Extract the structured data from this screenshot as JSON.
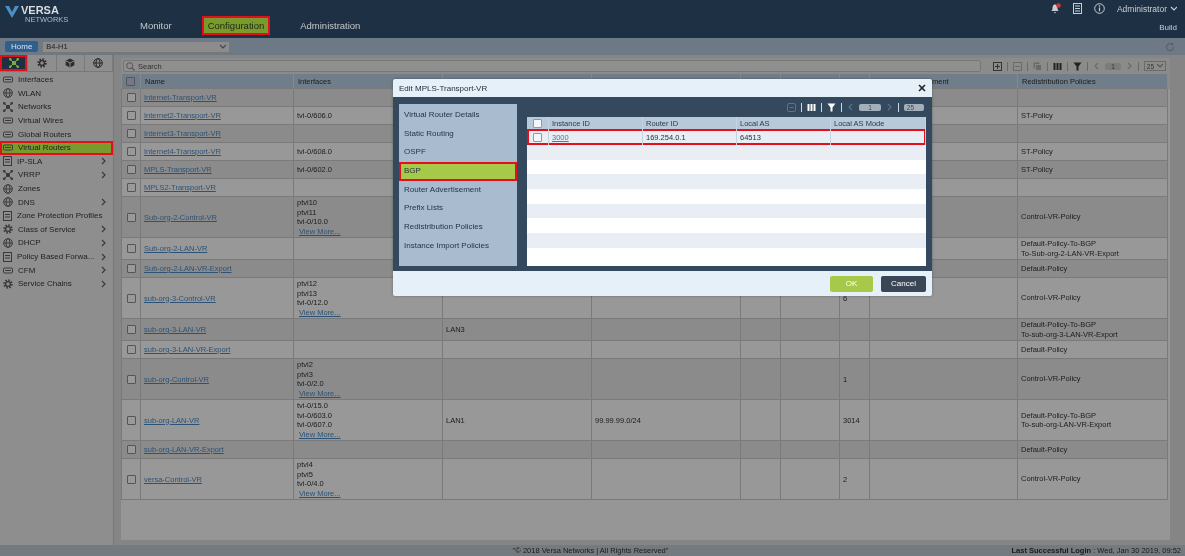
{
  "header": {
    "logo_text": "VERSA",
    "logo_subtext": "NETWORKS",
    "nav": [
      {
        "label": "Monitor",
        "selected": false,
        "highlighted": false
      },
      {
        "label": "Configuration",
        "selected": true,
        "highlighted": true
      },
      {
        "label": "Administration",
        "selected": false,
        "highlighted": false
      }
    ],
    "user": "Administrator",
    "build": "Build"
  },
  "location_bar": {
    "home": "Home",
    "appliance": "B4-H1"
  },
  "sidebar": {
    "tabs": [
      {
        "selected": true,
        "highlighted": true
      },
      {
        "selected": false,
        "highlighted": false
      },
      {
        "selected": false,
        "highlighted": false
      },
      {
        "selected": false,
        "highlighted": false
      }
    ],
    "items": [
      {
        "label": "Interfaces",
        "expandable": false,
        "selected": false,
        "highlighted": false
      },
      {
        "label": "WLAN",
        "expandable": false,
        "selected": false,
        "highlighted": false
      },
      {
        "label": "Networks",
        "expandable": false,
        "selected": false,
        "highlighted": false
      },
      {
        "label": "Virtual Wires",
        "expandable": false,
        "selected": false,
        "highlighted": false
      },
      {
        "label": "Global Routers",
        "expandable": false,
        "selected": false,
        "highlighted": false
      },
      {
        "label": "Virtual Routers",
        "expandable": false,
        "selected": true,
        "highlighted": true
      },
      {
        "label": "IP-SLA",
        "expandable": true,
        "selected": false,
        "highlighted": false
      },
      {
        "label": "VRRP",
        "expandable": true,
        "selected": false,
        "highlighted": false
      },
      {
        "label": "Zones",
        "expandable": false,
        "selected": false,
        "highlighted": false
      },
      {
        "label": "DNS",
        "expandable": true,
        "selected": false,
        "highlighted": false
      },
      {
        "label": "Zone Protection Profiles",
        "expandable": false,
        "selected": false,
        "highlighted": false
      },
      {
        "label": "Class of Service",
        "expandable": true,
        "selected": false,
        "highlighted": false
      },
      {
        "label": "DHCP",
        "expandable": true,
        "selected": false,
        "highlighted": false
      },
      {
        "label": "Policy Based Forwa...",
        "expandable": true,
        "selected": false,
        "highlighted": false
      },
      {
        "label": "CFM",
        "expandable": true,
        "selected": false,
        "highlighted": false
      },
      {
        "label": "Service Chains",
        "expandable": true,
        "selected": false,
        "highlighted": false
      }
    ]
  },
  "toolbar": {
    "search_placeholder": "Search",
    "page": "1",
    "page_size": "25"
  },
  "table": {
    "header": {
      "all_checked": false,
      "name": "Name",
      "interfaces": "Interfaces",
      "column_8": "ment",
      "redistribution_policies": "Redistribution Policies"
    },
    "rows": [
      {
        "checked": false,
        "name": "Internet-Transport-VR"
      },
      {
        "checked": false,
        "name": "Internet2-Transport-VR",
        "interfaces": [
          "tvi-0/606.0"
        ],
        "redistribution_policies": [
          "ST-Policy"
        ]
      },
      {
        "checked": false,
        "name": "Internet3-Transport-VR"
      },
      {
        "checked": false,
        "name": "Internet4-Transport-VR",
        "interfaces": [
          "tvi-0/608.0"
        ],
        "redistribution_policies": [
          "ST-Policy"
        ]
      },
      {
        "checked": false,
        "name": "MPLS-Transport-VR",
        "interfaces": [
          "tvi-0/602.0"
        ],
        "redistribution_policies": [
          "ST-Policy"
        ]
      },
      {
        "checked": false,
        "name": "MPLS2-Transport-VR"
      },
      {
        "checked": false,
        "name": "Sub-org-2-Control-VR",
        "interfaces": [
          "ptvi10",
          "ptvi11",
          "tvi-0/10.0"
        ],
        "view_more": "View More...",
        "redistribution_policies": [
          "Control-VR-Policy"
        ]
      },
      {
        "checked": false,
        "name": "Sub-org-2-LAN-VR",
        "redistribution_policies": [
          "Default-Policy-To-BGP",
          "To-Sub-org-2-LAN-VR-Export"
        ]
      },
      {
        "checked": false,
        "name": "Sub-org-2-LAN-VR-Export",
        "redistribution_policies": [
          "Default-Policy"
        ]
      },
      {
        "checked": false,
        "name": "sub-org-3-Control-VR",
        "interfaces": [
          "ptvi12",
          "ptvi13",
          "tvi-0/12.0"
        ],
        "view_more": "View More...",
        "column_7": "6",
        "redistribution_policies": [
          "Control-VR-Policy"
        ]
      },
      {
        "checked": false,
        "name": "sub-org-3-LAN-VR",
        "column_3": "LAN3",
        "redistribution_policies": [
          "Default-Policy-To-BGP",
          "To-sub-org-3-LAN-VR-Export"
        ]
      },
      {
        "checked": false,
        "name": "sub-org-3-LAN-VR-Export",
        "redistribution_policies": [
          "Default-Policy"
        ]
      },
      {
        "checked": false,
        "name": "sub-org-Control-VR",
        "interfaces": [
          "ptvi2",
          "ptvi3",
          "tvi-0/2.0"
        ],
        "view_more": "View More...",
        "column_7": "1",
        "redistribution_policies": [
          "Control-VR-Policy"
        ]
      },
      {
        "checked": false,
        "name": "sub-org-LAN-VR",
        "interfaces": [
          "tvi-0/15.0",
          "tvi-0/603.0",
          "tvi-0/607.0"
        ],
        "view_more": "View More...",
        "column_3": "LAN1",
        "column_4": "99.99.99.0/24",
        "column_7": "3014",
        "redistribution_policies": [
          "Default-Policy-To-BGP",
          "To-sub-org-LAN-VR-Export"
        ]
      },
      {
        "checked": false,
        "name": "sub-org-LAN-VR-Export",
        "redistribution_policies": [
          "Default-Policy"
        ]
      },
      {
        "checked": false,
        "name": "versa-Control-VR",
        "interfaces": [
          "ptvi4",
          "ptvi5",
          "tvi-0/4.0"
        ],
        "view_more": "View More...",
        "column_7": "2",
        "redistribution_policies": [
          "Control-VR-Policy"
        ]
      }
    ]
  },
  "modal": {
    "title": "Edit MPLS-Transport-VR",
    "menu": [
      {
        "label": "Virtual Router Details",
        "selected": false,
        "highlighted": false
      },
      {
        "label": "Static Routing",
        "selected": false,
        "highlighted": false
      },
      {
        "label": "OSPF",
        "selected": false,
        "highlighted": false
      },
      {
        "label": "BGP",
        "selected": true,
        "highlighted": true
      },
      {
        "label": "Router Advertisement",
        "selected": false,
        "highlighted": false
      },
      {
        "label": "Prefix Lists",
        "selected": false,
        "highlighted": false
      },
      {
        "label": "Redistribution Policies",
        "selected": false,
        "highlighted": false
      },
      {
        "label": "Instance Import Policies",
        "selected": false,
        "highlighted": false
      }
    ],
    "table": {
      "all_checked": false,
      "page": "1",
      "page_size": "25",
      "columns": [
        "Instance ID",
        "Router ID",
        "Local AS",
        "Local AS Mode"
      ],
      "rows": [
        {
          "checked": false,
          "highlighted": true,
          "cells": [
            "3000",
            "169.254.0.1",
            "64513"
          ]
        }
      ]
    },
    "buttons": [
      {
        "label": "OK",
        "kind": "primary"
      },
      {
        "label": "Cancel",
        "kind": "secondary"
      }
    ]
  },
  "footer": {
    "copyright": "\"© 2018 Versa Networks | All Rights Reserved\"",
    "last_login": "**Last Successful Login** : Wed, Jan 30 2019, 09:52"
  }
}
